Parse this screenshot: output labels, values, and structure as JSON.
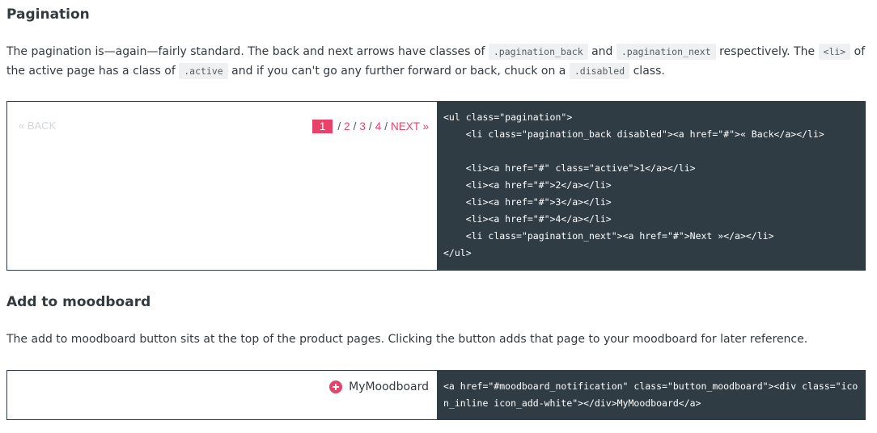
{
  "pagination": {
    "heading": "Pagination",
    "desc": {
      "t1": "The pagination is—again—fairly standard. The back and next arrows have classes of",
      "c1": ".pagination_back",
      "t2": "and",
      "c2": ".pagination_next",
      "t3": "respectively. The",
      "c3": "<li>",
      "t4": "of the active page has a class of",
      "c4": ".active",
      "t5": "and if you can't go any further forward or back, chuck on a",
      "c5": ".disabled",
      "t6": "class."
    },
    "demo": {
      "back_label": "« BACK",
      "pages": [
        "1",
        "2",
        "3",
        "4"
      ],
      "separator": "/",
      "next_label": "NEXT »",
      "active_page": "1"
    },
    "code": "<ul class=\"pagination\">\n    <li class=\"pagination_back disabled\"><a href=\"#\">« Back</a></li>\n\n    <li><a href=\"#\" class=\"active\">1</a></li>\n    <li><a href=\"#\">2</a></li>\n    <li><a href=\"#\">3</a></li>\n    <li><a href=\"#\">4</a></li>\n    <li class=\"pagination_next\"><a href=\"#\">Next »</a></li>\n</ul>"
  },
  "moodboard": {
    "heading": "Add to moodboard",
    "desc": "The add to moodboard button sits at the top of the product pages. Clicking the button adds that page to your moodboard for later reference.",
    "button_label": "MyMoodboard",
    "code": "<a href=\"#moodboard_notification\" class=\"button_moodboard\"><div class=\"icon_inline icon_add-white\"></div>MyMoodboard</a>"
  },
  "colors": {
    "accent": "#e8416a",
    "code_bg": "#2f3c43",
    "disabled": "#d3d6d8"
  }
}
